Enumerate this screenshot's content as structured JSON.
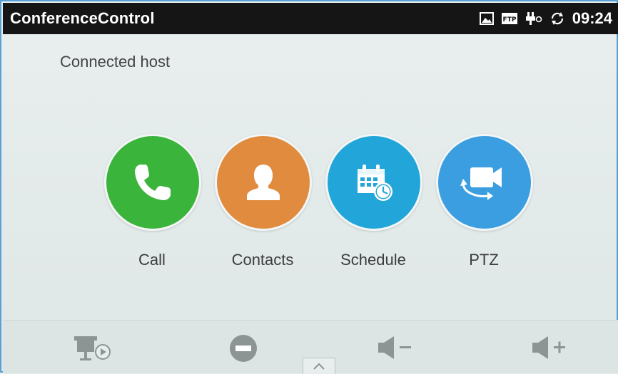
{
  "statusbar": {
    "app_title": "ConferenceControl",
    "icons": [
      "picture-icon",
      "ftp-icon",
      "usb-icon",
      "sync-icon"
    ],
    "ftp_label": "FTP",
    "time": "09:24"
  },
  "main": {
    "subtitle": "Connected host",
    "apps": [
      {
        "label": "Call",
        "icon": "phone-icon",
        "color": "#3bb43b"
      },
      {
        "label": "Contacts",
        "icon": "contact-icon",
        "color": "#e08b3e"
      },
      {
        "label": "Schedule",
        "icon": "calendar-clock-icon",
        "color": "#22a6d9"
      },
      {
        "label": "PTZ",
        "icon": "camera-rotate-icon",
        "color": "#3a9ee0"
      }
    ]
  },
  "bottombar": {
    "icons": [
      "presentation-icon",
      "mute-icon",
      "volume-down-icon",
      "volume-up-icon",
      "chevron-up-icon"
    ]
  }
}
